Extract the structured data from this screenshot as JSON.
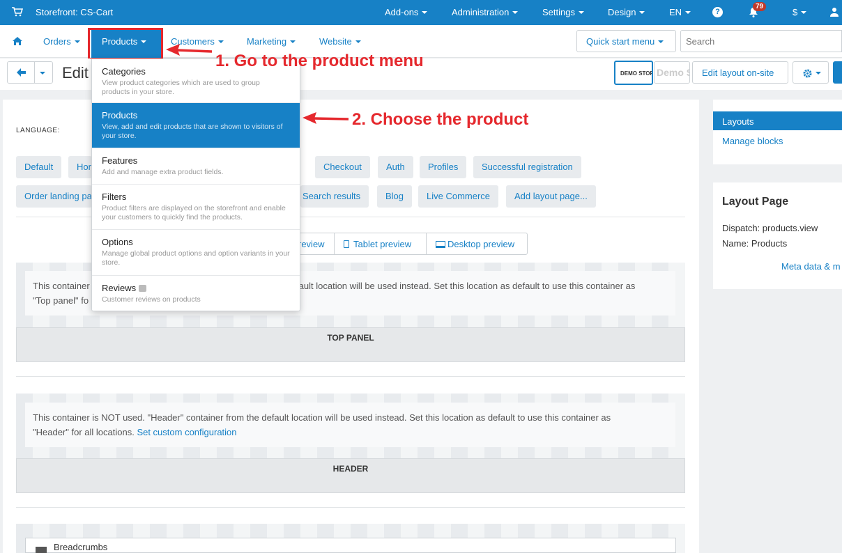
{
  "topbar": {
    "store": "Storefront: CS-Cart",
    "items": [
      "Add-ons",
      "Administration",
      "Settings",
      "Design",
      "EN"
    ],
    "notifications": "79",
    "currency": "$"
  },
  "menu": {
    "items": [
      "Orders",
      "Products",
      "Customers",
      "Marketing",
      "Website"
    ],
    "quick_start": "Quick start menu",
    "search_placeholder": "Search"
  },
  "toolbar": {
    "title": "Edit",
    "demo_label": "DEMO STORE",
    "demo_text": "Demo Sto",
    "edit_layout": "Edit layout on-site"
  },
  "main": {
    "language_label": "LANGUAGE:",
    "pills_row1": [
      "Default",
      "Hor",
      "Checkout",
      "Auth",
      "Profiles",
      "Successful registration"
    ],
    "pills_row2": [
      "Order landing pa",
      "Search results",
      "Blog",
      "Live Commerce",
      "Add layout page..."
    ],
    "previews": [
      "review",
      "Tablet preview",
      "Desktop preview"
    ],
    "notice1_line1": "This container",
    "notice1_line1b": "ault location will be used instead. Set this location as default to use this container as",
    "notice1_line2": "\"Top panel\" fo",
    "top_panel": "TOP PANEL",
    "notice2_line1": "This container is NOT used. \"Header\" container from the default location will be used instead. Set this location as default to use this container as",
    "notice2_line2": "\"Header\" for all locations.",
    "notice2_link": "Set custom configuration",
    "header": "HEADER",
    "breadcrumbs": "Breadcrumbs"
  },
  "right": {
    "layouts": "Layouts",
    "manage_blocks": "Manage blocks",
    "layout_page": "Layout Page",
    "dispatch": "Dispatch: products.view",
    "name": "Name: Products",
    "meta_link": "Meta data & m"
  },
  "dropdown": [
    {
      "title": "Categories",
      "desc": "View product categories which are used to group products in your store."
    },
    {
      "title": "Products",
      "desc": "View, add and edit products that are shown to visitors of your store."
    },
    {
      "title": "Features",
      "desc": "Add and manage extra product fields."
    },
    {
      "title": "Filters",
      "desc": "Product filters are displayed on the storefront and enable your customers to quickly find the products."
    },
    {
      "title": "Options",
      "desc": "Manage global product options and option variants in your store."
    },
    {
      "title": "Reviews",
      "desc": "Customer reviews on products"
    }
  ],
  "annotations": {
    "step1": "1. Go to the product menu",
    "step2": "2. Choose the product"
  },
  "colors": {
    "accent": "#1781c6",
    "annotation": "#e5282d"
  }
}
